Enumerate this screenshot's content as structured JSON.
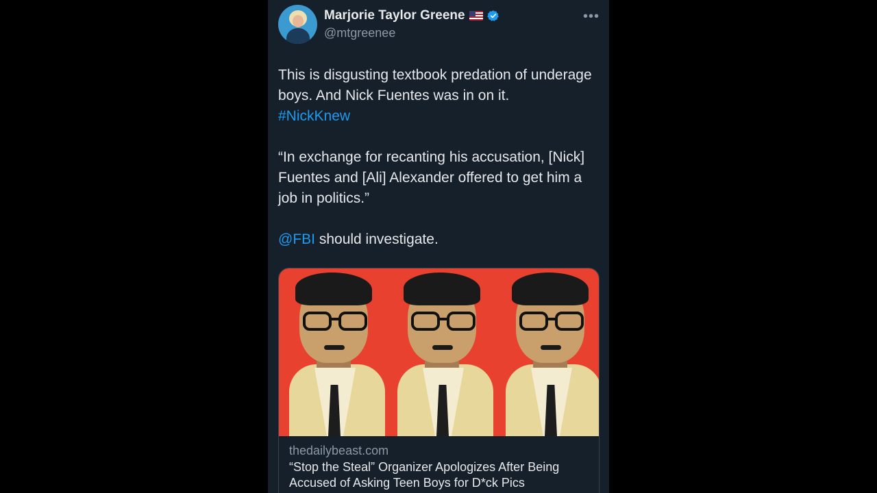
{
  "author": {
    "name": "Marjorie Taylor Greene",
    "handle": "@mtgreenee",
    "flag_icon": "us-flag-icon",
    "verified_icon": "verified-badge-icon"
  },
  "menu": {
    "more_label": "•••"
  },
  "tweet": {
    "line1": "This is disgusting textbook predation of underage boys. And Nick Fuentes was in on it.",
    "hashtag": "#NickKnew",
    "quote": "“In exchange for recanting his accusation, [Nick] Fuentes and [Ali] Alexander offered to get him a job in politics.”",
    "mention": "@FBI",
    "mention_suffix": " should investigate."
  },
  "card": {
    "domain": "thedailybeast.com",
    "headline": "“Stop the Steal” Organizer Apologizes After Being Accused of Asking Teen Boys for D*ck Pics"
  },
  "colors": {
    "background": "#15202b",
    "text": "#e7e9ea",
    "secondary": "#8b98a5",
    "link": "#1d9bf0",
    "card_image_bg": "#e8412f"
  }
}
